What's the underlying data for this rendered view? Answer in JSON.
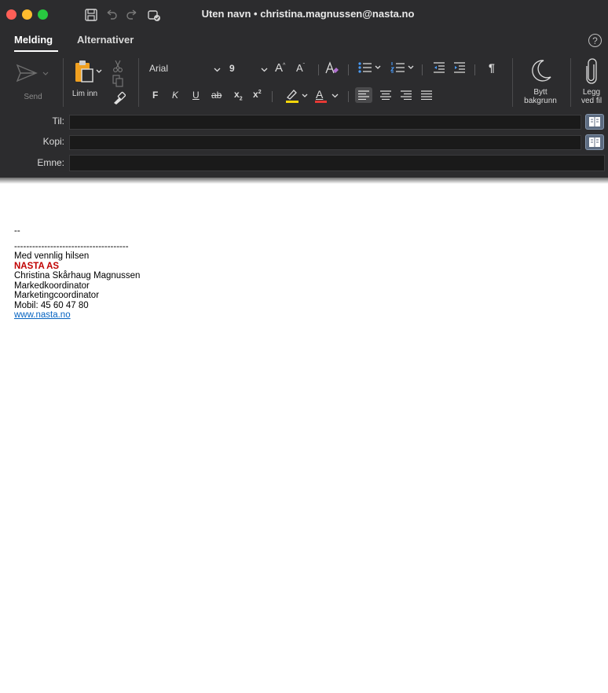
{
  "window": {
    "title": "Uten navn • christina.magnussen@nasta.no"
  },
  "tabs": [
    "Melding",
    "Alternativer"
  ],
  "ribbon": {
    "send_label": "Send",
    "paste_label": "Lim inn",
    "font_name": "Arial",
    "font_size": "9",
    "bold": "F",
    "italic": "K",
    "underline": "U",
    "strike": "ab",
    "subscript": "x",
    "superscript": "x",
    "font_color": "A",
    "paragraph": "¶",
    "background_label_1": "Bytt",
    "background_label_2": "bakgrunn",
    "attach_label_1": "Legg",
    "attach_label_2": "ved fil"
  },
  "fields": {
    "to_label": "Til:",
    "cc_label": "Kopi:",
    "subject_label": "Emne:",
    "to_value": "",
    "cc_value": "",
    "subject_value": ""
  },
  "signature": {
    "dashes": "--",
    "separator": "--------------------------------------",
    "greeting": "Med vennlig hilsen",
    "company": "NASTA AS",
    "name": "Christina Skårhaug Magnussen",
    "title_no": "Markedkoordinator",
    "title_en": "Marketingcoordinator",
    "mobile": "Mobil: 45 60 47 80",
    "website": "www.nasta.no"
  },
  "colors": {
    "chrome": "#2c2c2e",
    "company_red": "#c00000",
    "link_blue": "#0563c1",
    "highlight_yellow": "#f5d60a",
    "font_red": "#e53935"
  },
  "icons": [
    "save-icon",
    "undo-icon",
    "redo-icon",
    "clip-icon",
    "send-icon",
    "paste-icon",
    "cut-icon",
    "copy-icon",
    "format-painter-icon",
    "grow-font-icon",
    "shrink-font-icon",
    "clear-format-icon",
    "bullets-icon",
    "numbering-icon",
    "decrease-indent-icon",
    "increase-indent-icon",
    "moon-icon",
    "paperclip-icon",
    "address-book-icon"
  ]
}
